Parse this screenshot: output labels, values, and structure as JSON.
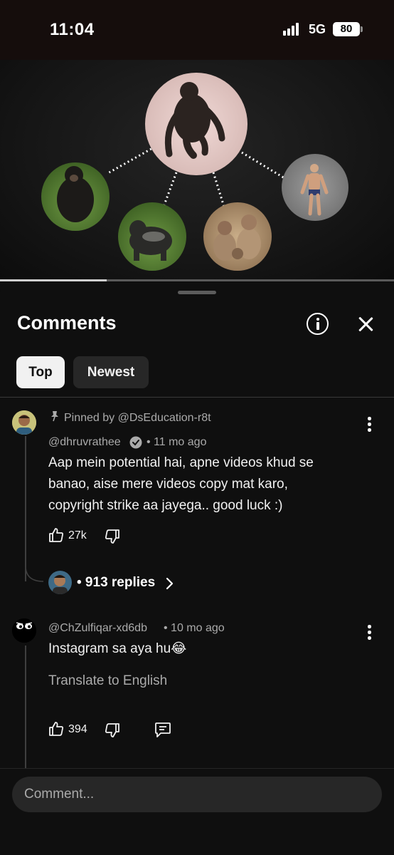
{
  "status_bar": {
    "time": "11:04",
    "network": "5G",
    "battery": "80"
  },
  "video": {
    "thumbnail_icons": [
      "chimpanzee-center",
      "chimpanzee-left",
      "gorilla",
      "macaque-monkeys",
      "human-figure"
    ],
    "progress_fraction": 0.27
  },
  "panel": {
    "title": "Comments",
    "info_icon": "info-icon",
    "close_icon": "close-icon"
  },
  "filters": [
    {
      "label": "Top",
      "selected": true
    },
    {
      "label": "Newest",
      "selected": false
    }
  ],
  "comments": [
    {
      "pinned_label": "Pinned by @DsEducation-r8t",
      "author": "@dhruvrathee",
      "verified": true,
      "time": "• 11 mo ago",
      "lines": [
        "Aap mein potential hai, apne videos khud se",
        "banao, aise mere videos copy mat karo,",
        "copyright strike aa jayega.. good luck :)"
      ],
      "likes": "27k",
      "replies": "• 913 replies"
    },
    {
      "author": "@ChZulfiqar-xd6db",
      "time": "• 10 mo ago",
      "text": "Instagram sa aya hu😂",
      "translate": "Translate to English",
      "likes": "394"
    }
  ],
  "composer": {
    "placeholder": "Comment..."
  },
  "colors": {
    "background": "#0f0f0f",
    "chip_active": "#f1f1f1",
    "chip_inactive": "#272727",
    "secondary_text": "#aaaaaa"
  }
}
